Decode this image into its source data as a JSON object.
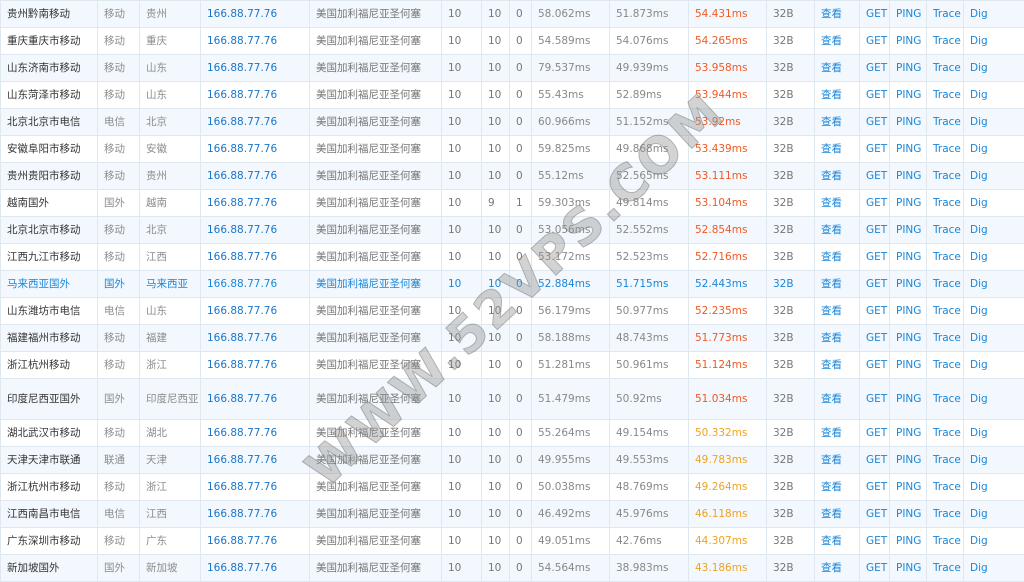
{
  "actions": {
    "view": "查看",
    "get": "GET",
    "ping": "PING",
    "trace": "Trace",
    "dig": "Dig"
  },
  "watermark": "WWW.52VPS.COM",
  "rows": [
    {
      "node": "贵州黔南移动",
      "isp": "移动",
      "province": "贵州",
      "ip": "166.88.77.76",
      "location": "美国加利福尼亚圣何塞",
      "sent": "10",
      "recv": "10",
      "lost": "0",
      "max": "58.062ms",
      "min": "51.873ms",
      "avg": "54.431ms",
      "size": "32B"
    },
    {
      "node": "重庆重庆市移动",
      "isp": "移动",
      "province": "重庆",
      "ip": "166.88.77.76",
      "location": "美国加利福尼亚圣何塞",
      "sent": "10",
      "recv": "10",
      "lost": "0",
      "max": "54.589ms",
      "min": "54.076ms",
      "avg": "54.265ms",
      "size": "32B"
    },
    {
      "node": "山东济南市移动",
      "isp": "移动",
      "province": "山东",
      "ip": "166.88.77.76",
      "location": "美国加利福尼亚圣何塞",
      "sent": "10",
      "recv": "10",
      "lost": "0",
      "max": "79.537ms",
      "min": "49.939ms",
      "avg": "53.958ms",
      "size": "32B"
    },
    {
      "node": "山东菏泽市移动",
      "isp": "移动",
      "province": "山东",
      "ip": "166.88.77.76",
      "location": "美国加利福尼亚圣何塞",
      "sent": "10",
      "recv": "10",
      "lost": "0",
      "max": "55.43ms",
      "min": "52.89ms",
      "avg": "53.944ms",
      "size": "32B"
    },
    {
      "node": "北京北京市电信",
      "isp": "电信",
      "province": "北京",
      "ip": "166.88.77.76",
      "location": "美国加利福尼亚圣何塞",
      "sent": "10",
      "recv": "10",
      "lost": "0",
      "max": "60.966ms",
      "min": "51.152ms",
      "avg": "53.92ms",
      "size": "32B"
    },
    {
      "node": "安徽阜阳市移动",
      "isp": "移动",
      "province": "安徽",
      "ip": "166.88.77.76",
      "location": "美国加利福尼亚圣何塞",
      "sent": "10",
      "recv": "10",
      "lost": "0",
      "max": "59.825ms",
      "min": "49.868ms",
      "avg": "53.439ms",
      "size": "32B"
    },
    {
      "node": "贵州贵阳市移动",
      "isp": "移动",
      "province": "贵州",
      "ip": "166.88.77.76",
      "location": "美国加利福尼亚圣何塞",
      "sent": "10",
      "recv": "10",
      "lost": "0",
      "max": "55.12ms",
      "min": "52.565ms",
      "avg": "53.111ms",
      "size": "32B"
    },
    {
      "node": "越南国外",
      "isp": "国外",
      "province": "越南",
      "ip": "166.88.77.76",
      "location": "美国加利福尼亚圣何塞",
      "sent": "10",
      "recv": "9",
      "lost": "1",
      "max": "59.303ms",
      "min": "49.814ms",
      "avg": "53.104ms",
      "size": "32B"
    },
    {
      "node": "北京北京市移动",
      "isp": "移动",
      "province": "北京",
      "ip": "166.88.77.76",
      "location": "美国加利福尼亚圣何塞",
      "sent": "10",
      "recv": "10",
      "lost": "0",
      "max": "53.056ms",
      "min": "52.552ms",
      "avg": "52.854ms",
      "size": "32B"
    },
    {
      "node": "江西九江市移动",
      "isp": "移动",
      "province": "江西",
      "ip": "166.88.77.76",
      "location": "美国加利福尼亚圣何塞",
      "sent": "10",
      "recv": "10",
      "lost": "0",
      "max": "53.172ms",
      "min": "52.523ms",
      "avg": "52.716ms",
      "size": "32B"
    },
    {
      "node": "马来西亚国外",
      "isp": "国外",
      "province": "马来西亚",
      "ip": "166.88.77.76",
      "location": "美国加利福尼亚圣何塞",
      "sent": "10",
      "recv": "10",
      "lost": "0",
      "max": "52.884ms",
      "min": "51.715ms",
      "avg": "52.443ms",
      "size": "32B",
      "highlight": true
    },
    {
      "node": "山东潍坊市电信",
      "isp": "电信",
      "province": "山东",
      "ip": "166.88.77.76",
      "location": "美国加利福尼亚圣何塞",
      "sent": "10",
      "recv": "10",
      "lost": "0",
      "max": "56.179ms",
      "min": "50.977ms",
      "avg": "52.235ms",
      "size": "32B"
    },
    {
      "node": "福建福州市移动",
      "isp": "移动",
      "province": "福建",
      "ip": "166.88.77.76",
      "location": "美国加利福尼亚圣何塞",
      "sent": "10",
      "recv": "10",
      "lost": "0",
      "max": "58.188ms",
      "min": "48.743ms",
      "avg": "51.773ms",
      "size": "32B"
    },
    {
      "node": "浙江杭州移动",
      "isp": "移动",
      "province": "浙江",
      "ip": "166.88.77.76",
      "location": "美国加利福尼亚圣何塞",
      "sent": "10",
      "recv": "10",
      "lost": "0",
      "max": "51.281ms",
      "min": "50.961ms",
      "avg": "51.124ms",
      "size": "32B"
    },
    {
      "node": "印度尼西亚国外",
      "isp": "国外",
      "province": "印度尼西亚",
      "ip": "166.88.77.76",
      "location": "美国加利福尼亚圣何塞",
      "sent": "10",
      "recv": "10",
      "lost": "0",
      "max": "51.479ms",
      "min": "50.92ms",
      "avg": "51.034ms",
      "size": "32B",
      "tall": true
    },
    {
      "node": "湖北武汉市移动",
      "isp": "移动",
      "province": "湖北",
      "ip": "166.88.77.76",
      "location": "美国加利福尼亚圣何塞",
      "sent": "10",
      "recv": "10",
      "lost": "0",
      "max": "55.264ms",
      "min": "49.154ms",
      "avg": "50.332ms",
      "size": "32B"
    },
    {
      "node": "天津天津市联通",
      "isp": "联通",
      "province": "天津",
      "ip": "166.88.77.76",
      "location": "美国加利福尼亚圣何塞",
      "sent": "10",
      "recv": "10",
      "lost": "0",
      "max": "49.955ms",
      "min": "49.553ms",
      "avg": "49.783ms",
      "size": "32B"
    },
    {
      "node": "浙江杭州市移动",
      "isp": "移动",
      "province": "浙江",
      "ip": "166.88.77.76",
      "location": "美国加利福尼亚圣何塞",
      "sent": "10",
      "recv": "10",
      "lost": "0",
      "max": "50.038ms",
      "min": "48.769ms",
      "avg": "49.264ms",
      "size": "32B"
    },
    {
      "node": "江西南昌市电信",
      "isp": "电信",
      "province": "江西",
      "ip": "166.88.77.76",
      "location": "美国加利福尼亚圣何塞",
      "sent": "10",
      "recv": "10",
      "lost": "0",
      "max": "46.492ms",
      "min": "45.976ms",
      "avg": "46.118ms",
      "size": "32B"
    },
    {
      "node": "广东深圳市移动",
      "isp": "移动",
      "province": "广东",
      "ip": "166.88.77.76",
      "location": "美国加利福尼亚圣何塞",
      "sent": "10",
      "recv": "10",
      "lost": "0",
      "max": "49.051ms",
      "min": "42.76ms",
      "avg": "44.307ms",
      "size": "32B"
    },
    {
      "node": "新加坡国外",
      "isp": "国外",
      "province": "新加坡",
      "ip": "166.88.77.76",
      "location": "美国加利福尼亚圣何塞",
      "sent": "10",
      "recv": "10",
      "lost": "0",
      "max": "54.564ms",
      "min": "38.983ms",
      "avg": "43.186ms",
      "size": "32B"
    }
  ]
}
